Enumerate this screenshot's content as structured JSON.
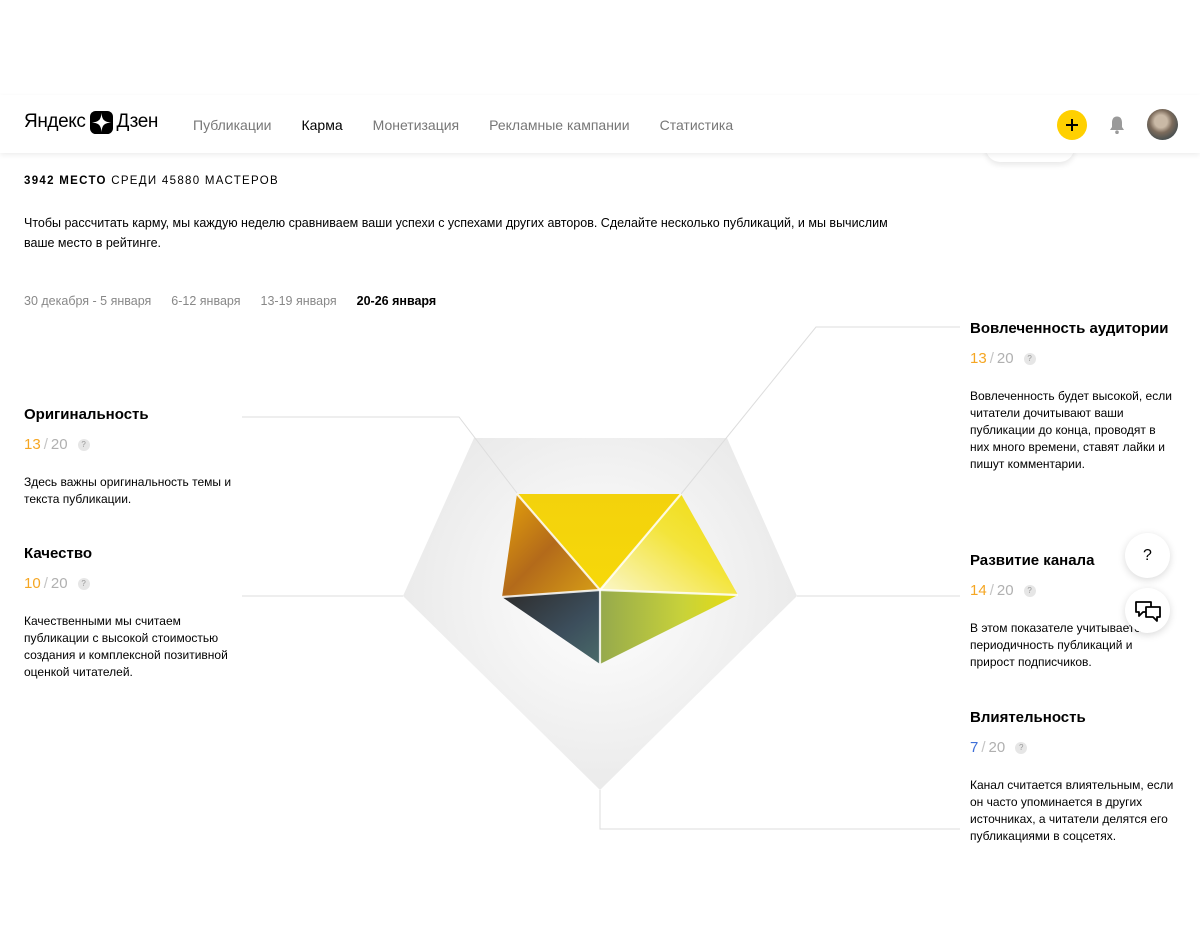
{
  "header": {
    "logo_text_left": "Яндекс",
    "logo_text_right": "Дзен",
    "nav": [
      {
        "label": "Публикации",
        "active": false
      },
      {
        "label": "Карма",
        "active": true
      },
      {
        "label": "Монетизация",
        "active": false
      },
      {
        "label": "Рекламные кампании",
        "active": false
      },
      {
        "label": "Статистика",
        "active": false
      }
    ],
    "add_icon": "plus-icon",
    "bell_icon": "bell-icon"
  },
  "rank": {
    "place_bold": "3942 место",
    "place_rest": " среди 45880 мастеров"
  },
  "intro": "Чтобы рассчитать карму, мы каждую неделю сравниваем ваши успехи с успехами других авторов. Сделайте несколько публикаций, и мы вычислим ваше место в рейтинге.",
  "weeks": [
    {
      "label": "30 декабря - 5 января",
      "active": false
    },
    {
      "label": "6-12 января",
      "active": false
    },
    {
      "label": "13-19 января",
      "active": false
    },
    {
      "label": "20-26 января",
      "active": true
    }
  ],
  "metrics": {
    "originality": {
      "title": "Оригинальность",
      "value": 13,
      "max": "20",
      "desc": "Здесь важны оригинальность темы и текста публикации."
    },
    "quality": {
      "title": "Качество",
      "value": 10,
      "max": "20",
      "desc": "Качественными мы считаем публикации с высокой стоимостью создания и комплексной позитивной оценкой читателей."
    },
    "engagement": {
      "title": "Вовлеченность аудитории",
      "value": 13,
      "max": "20",
      "desc": "Вовлеченность будет высокой, если читатели дочитывают ваши публикации до конца, проводят в них много времени, ставят лайки и пишут комментарии."
    },
    "growth": {
      "title": "Развитие канала",
      "value": 14,
      "max": "20",
      "desc": "В этом показателе учитывается периодичность публикаций и прирост подписчиков."
    },
    "influence": {
      "title": "Влиятельность",
      "value": 7,
      "max": "20",
      "desc": "Канал считается влиятельным, если он часто упоминается в других источниках, а читатели делятся его публикациями в соцсетях."
    }
  },
  "colors": {
    "accent": "#ffd000",
    "score_orange": "#f5a623",
    "score_blue": "#3f6fd8"
  },
  "help_glyph": "?",
  "floating": {
    "help_label": "?",
    "chat_icon": "chat-bubbles-icon"
  }
}
